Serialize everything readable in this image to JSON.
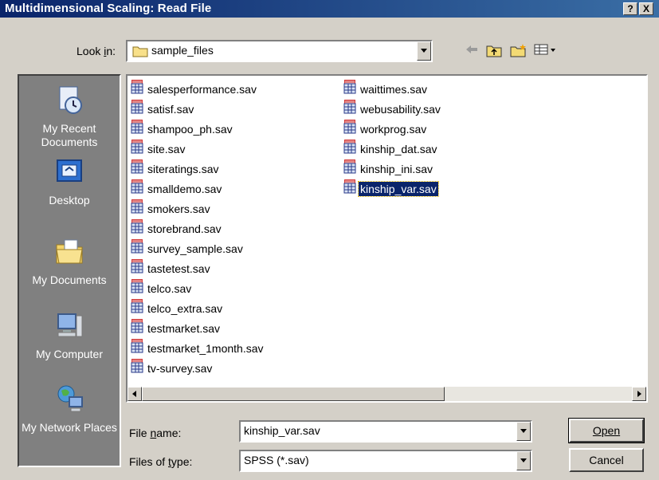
{
  "window": {
    "title": "Multidimensional Scaling: Read File",
    "help_label": "?",
    "close_label": "X"
  },
  "lookin": {
    "label": "Look in:",
    "value": "sample_files"
  },
  "places": [
    {
      "label": "My Recent Documents",
      "icon": "recent-documents-icon"
    },
    {
      "label": "Desktop",
      "icon": "desktop-icon"
    },
    {
      "label": "My Documents",
      "icon": "my-documents-icon"
    },
    {
      "label": "My Computer",
      "icon": "my-computer-icon"
    },
    {
      "label": "My Network Places",
      "icon": "network-places-icon"
    }
  ],
  "files_col1": [
    "salesperformance.sav",
    "satisf.sav",
    "shampoo_ph.sav",
    "site.sav",
    "siteratings.sav",
    "smalldemo.sav",
    "smokers.sav",
    "storebrand.sav",
    "survey_sample.sav",
    "tastetest.sav",
    "telco.sav",
    "telco_extra.sav",
    "testmarket.sav",
    "testmarket_1month.sav",
    "tv-survey.sav"
  ],
  "files_col2": [
    "waittimes.sav",
    "webusability.sav",
    "workprog.sav",
    "kinship_dat.sav",
    "kinship_ini.sav",
    "kinship_var.sav"
  ],
  "selected_file": "kinship_var.sav",
  "filename": {
    "label": "File name:",
    "value": "kinship_var.sav"
  },
  "filetype": {
    "label": "Files of type:",
    "value": "SPSS (*.sav)"
  },
  "buttons": {
    "open": "Open",
    "cancel": "Cancel"
  },
  "colors": {
    "titlebar_start": "#0a246a",
    "titlebar_end": "#3a6ea5",
    "selection": "#0a246a",
    "places_bg": "#808080",
    "dialog_bg": "#d4d0c8"
  }
}
